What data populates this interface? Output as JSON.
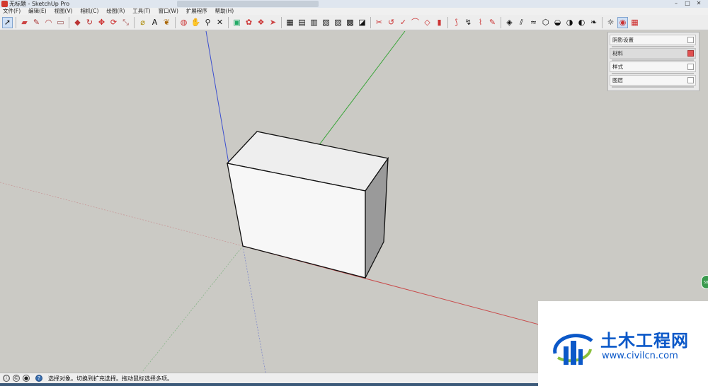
{
  "window": {
    "title": "无标题 - SketchUp Pro"
  },
  "menus": [
    "文件(F)",
    "编辑(E)",
    "视图(V)",
    "相机(C)",
    "绘图(R)",
    "工具(T)",
    "窗口(W)",
    "扩展程序",
    "帮助(H)"
  ],
  "tray": {
    "panels": [
      {
        "label": "阴影设置"
      },
      {
        "label": "材料"
      },
      {
        "label": "样式"
      },
      {
        "label": "图层"
      }
    ]
  },
  "status": {
    "text": "选择对象。切换到扩充选择。拖动鼠标选择多项。"
  },
  "badge": {
    "text": "58"
  },
  "watermark": {
    "brand": "土木工程网",
    "url": "www.civilcn.com"
  },
  "colors": {
    "red_axis": "#c84a4a",
    "green_axis": "#3aa53a",
    "blue_axis": "#3c4fd0",
    "brand": "#0b58c8"
  },
  "toolbar_icons": [
    "select-icon",
    "eraser-icon",
    "pencil-icon",
    "arc-icon",
    "rectangle-icon",
    "push-pull-icon",
    "follow-me-icon",
    "move-icon",
    "rotate-icon",
    "scale-icon",
    "tape-measure-icon",
    "text-icon",
    "paint-bucket-icon",
    "orbit-icon",
    "pan-icon",
    "zoom-icon",
    "zoom-extents-icon",
    "warehouse-icon",
    "extension-icon",
    "sandbox-icon",
    "solid-tools-icon",
    "section-icon",
    "style-icon",
    "layer-icon",
    "shadow-icon"
  ]
}
